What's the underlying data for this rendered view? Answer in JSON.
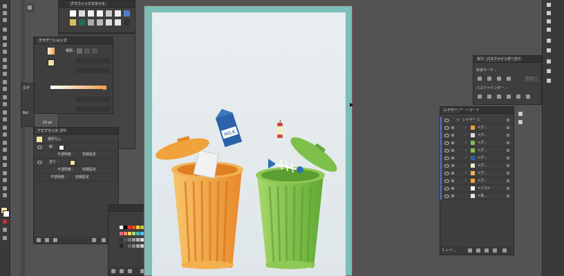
{
  "graphic_styles": {
    "title": "グラフィックスタイル"
  },
  "gradient": {
    "title": "グラデーション",
    "tab2": "透",
    "type_label": "種類 :"
  },
  "appearance": {
    "tab1": "アピアランス",
    "tab2": "透明",
    "no_selection": "選択なし",
    "stroke": "線 :",
    "opacity1": "不透明度 :",
    "opacity1_val": "初期設定",
    "fill": "塗り :",
    "opacity2": "不透明度 :",
    "opacity2_val": "初期設定",
    "opacity3": "不透明度 :",
    "opacity3_val": "初期設定"
  },
  "character": {
    "abbr": "文字",
    "font_style": "Bol",
    "size": "15 pt"
  },
  "pathfinder": {
    "tab1": "整列",
    "tab2": "パスファインダー",
    "tab3": "変形",
    "shape_modes": "形状モード :",
    "expand": "拡張",
    "pathfinders": "パスファインダー :"
  },
  "layers": {
    "tab1": "レイヤー",
    "tab2": "アートボード",
    "top_layer": "レイヤー 1",
    "items": [
      "<グ...",
      "<グ...",
      "<グ...",
      "<グ...",
      "<グ...",
      "<グ...",
      "<グ...",
      "<グ...",
      "<パス>",
      "<長..."
    ],
    "footer": "1 レイ..."
  },
  "artwork": {
    "milk_label": "MILK"
  },
  "colors": {
    "workspace": "#535353",
    "panel": "#3e3e3e",
    "artboard_frame": "#7bbfb8",
    "artboard": "#e4ebee",
    "orange_can": "#f0a23c",
    "green_can": "#84c24a",
    "milk": "#2c63a8"
  }
}
